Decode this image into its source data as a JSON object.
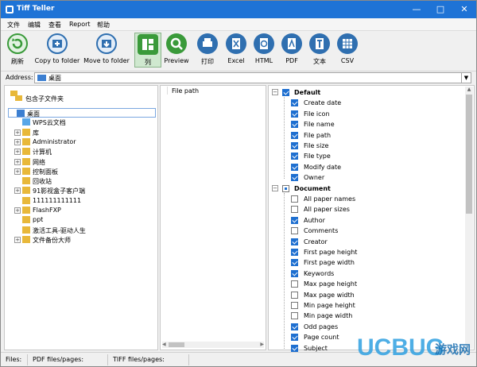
{
  "window": {
    "title": "Tiff Teller"
  },
  "menu": [
    "文件",
    "编辑",
    "查看",
    "Report",
    "帮助"
  ],
  "toolbar": [
    {
      "label": "刷新",
      "icon": "refresh-icon",
      "color": "#3a9a3a"
    },
    {
      "label": "Copy to folder",
      "icon": "copy-folder-icon",
      "color": "#2f6fb0"
    },
    {
      "label": "Move to folder",
      "icon": "move-folder-icon",
      "color": "#2f6fb0"
    },
    {
      "label": "列",
      "icon": "columns-icon",
      "color": "#3a9a3a",
      "selected": true
    },
    {
      "label": "Preview",
      "icon": "preview-icon",
      "color": "#3a9a3a"
    },
    {
      "label": "打印",
      "icon": "print-icon",
      "color": "#2f6fb0"
    },
    {
      "label": "Excel",
      "icon": "excel-icon",
      "color": "#2f6fb0"
    },
    {
      "label": "HTML",
      "icon": "html-icon",
      "color": "#2f6fb0"
    },
    {
      "label": "PDF",
      "icon": "pdf-icon",
      "color": "#2f6fb0"
    },
    {
      "label": "文本",
      "icon": "text-icon",
      "color": "#2f6fb0"
    },
    {
      "label": "CSV",
      "icon": "csv-icon",
      "color": "#2f6fb0"
    }
  ],
  "address": {
    "label": "Address:",
    "value": "桌面"
  },
  "left_panel": {
    "include_subfolders": "包含子文件夹",
    "tree": [
      {
        "label": "桌面",
        "selected": true,
        "expander": ""
      },
      {
        "label": "WPS云文档",
        "expander": ""
      },
      {
        "label": "库",
        "expander": "+"
      },
      {
        "label": "Administrator",
        "expander": "+"
      },
      {
        "label": "计算机",
        "expander": "+"
      },
      {
        "label": "网络",
        "expander": "+"
      },
      {
        "label": "控制面板",
        "expander": "+"
      },
      {
        "label": "回收站",
        "expander": ""
      },
      {
        "label": "91影视盒子客户端",
        "expander": "+"
      },
      {
        "label": "111111111111",
        "expander": ""
      },
      {
        "label": "FlashFXP",
        "expander": "+"
      },
      {
        "label": "ppt",
        "expander": ""
      },
      {
        "label": "激活工具-驱动人生",
        "expander": ""
      },
      {
        "label": "文件备份大师",
        "expander": "+"
      }
    ]
  },
  "middle_panel": {
    "column_header": "File path"
  },
  "right_panel": {
    "groups": [
      {
        "label": "Default",
        "state": "on",
        "items": [
          {
            "label": "Create date",
            "checked": true
          },
          {
            "label": "File icon",
            "checked": true
          },
          {
            "label": "File name",
            "checked": true
          },
          {
            "label": "File path",
            "checked": true
          },
          {
            "label": "File size",
            "checked": true
          },
          {
            "label": "File type",
            "checked": true
          },
          {
            "label": "Modify date",
            "checked": true
          },
          {
            "label": "Owner",
            "checked": true
          }
        ]
      },
      {
        "label": "Document",
        "state": "partial",
        "items": [
          {
            "label": "All paper names",
            "checked": false
          },
          {
            "label": "All paper sizes",
            "checked": false
          },
          {
            "label": "Author",
            "checked": true
          },
          {
            "label": "Comments",
            "checked": false
          },
          {
            "label": "Creator",
            "checked": true
          },
          {
            "label": "First page height",
            "checked": true
          },
          {
            "label": "First page width",
            "checked": true
          },
          {
            "label": "Keywords",
            "checked": true
          },
          {
            "label": "Max page height",
            "checked": false
          },
          {
            "label": "Max page width",
            "checked": false
          },
          {
            "label": "Min page height",
            "checked": false
          },
          {
            "label": "Min page width",
            "checked": false
          },
          {
            "label": "Odd pages",
            "checked": true
          },
          {
            "label": "Page count",
            "checked": true
          },
          {
            "label": "Subject",
            "checked": true
          }
        ]
      }
    ]
  },
  "status": {
    "files": "Files:",
    "pdf": "PDF files/pages:",
    "tiff": "TIFF files/pages:"
  },
  "watermark": "UCBUG游戏网"
}
